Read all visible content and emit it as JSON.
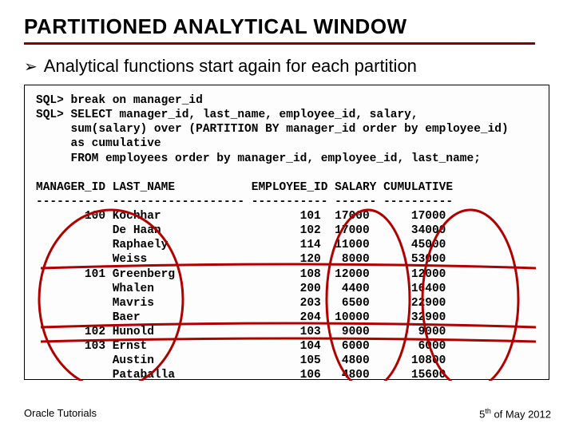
{
  "title": "PARTITIONED ANALYTICAL WINDOW",
  "bullet": "Analytical functions start again for each partition",
  "sql_block": "SQL> break on manager_id\nSQL> SELECT manager_id, last_name, employee_id, salary,\n     sum(salary) over (PARTITION BY manager_id order by employee_id)\n     as cumulative\n     FROM employees order by manager_id, employee_id, last_name;",
  "header_row": "MANAGER_ID LAST_NAME           EMPLOYEE_ID SALARY CUMULATIVE",
  "divider_row": "---------- ------------------- ----------- ------ ----------",
  "rows": [
    {
      "mgr": "       100",
      "last": "Kochhar    ",
      "emp": "        101",
      "sal": " 17000",
      "cum": "     17000"
    },
    {
      "mgr": "          ",
      "last": "De Haan    ",
      "emp": "        102",
      "sal": " 17000",
      "cum": "     34000"
    },
    {
      "mgr": "          ",
      "last": "Raphaely   ",
      "emp": "        114",
      "sal": " 11000",
      "cum": "     45000"
    },
    {
      "mgr": "          ",
      "last": "Weiss      ",
      "emp": "        120",
      "sal": "  8000",
      "cum": "     53000"
    },
    {
      "mgr": "       101",
      "last": "Greenberg  ",
      "emp": "        108",
      "sal": " 12000",
      "cum": "     12000"
    },
    {
      "mgr": "          ",
      "last": "Whalen     ",
      "emp": "        200",
      "sal": "  4400",
      "cum": "     16400"
    },
    {
      "mgr": "          ",
      "last": "Mavris     ",
      "emp": "        203",
      "sal": "  6500",
      "cum": "     22900"
    },
    {
      "mgr": "          ",
      "last": "Baer       ",
      "emp": "        204",
      "sal": " 10000",
      "cum": "     32900"
    },
    {
      "mgr": "       102",
      "last": "Hunold     ",
      "emp": "        103",
      "sal": "  9000",
      "cum": "      9000"
    },
    {
      "mgr": "       103",
      "last": "Ernst      ",
      "emp": "        104",
      "sal": "  6000",
      "cum": "      6000"
    },
    {
      "mgr": "          ",
      "last": "Austin     ",
      "emp": "        105",
      "sal": "  4800",
      "cum": "     10800"
    },
    {
      "mgr": "          ",
      "last": "Pataballa  ",
      "emp": "        106",
      "sal": "  4800",
      "cum": "     15600"
    }
  ],
  "footer_left": "Oracle Tutorials",
  "footer_right_prefix": "5",
  "footer_right_sup": "th",
  "footer_right_suffix": " of May 2012"
}
